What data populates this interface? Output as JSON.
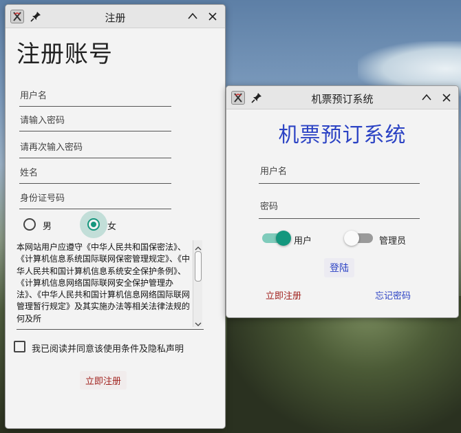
{
  "register_window": {
    "title": "注册",
    "heading": "注册账号",
    "fields": {
      "username_placeholder": "用户名",
      "password_placeholder": "请输入密码",
      "confirm_password_placeholder": "请再次输入密码",
      "name_placeholder": "姓名",
      "id_number_placeholder": "身份证号码"
    },
    "gender": {
      "male_label": "男",
      "female_label": "女",
      "selected": "女"
    },
    "terms_text": "本网站用户应遵守《中华人民共和国保密法》、《计算机信息系统国际联网保密管理规定》、《中华人民共和国计算机信息系统安全保护条例》、《计算机信息网络国际联网安全保护管理办法》、《中华人民共和国计算机信息网络国际联网管理暂行规定》及其实施办法等相关法律法规的何及所",
    "agree_checkbox_label": "我已阅读并同意该使用条件及隐私声明",
    "agree_checked": false,
    "submit_label": "立即注册"
  },
  "login_window": {
    "title": "机票预订系统",
    "heading": "机票预订系统",
    "username_placeholder": "用户名",
    "password_placeholder": "密码",
    "user_switch": {
      "label": "用户",
      "on": true
    },
    "admin_switch": {
      "label": "管理员",
      "on": false
    },
    "login_label": "登陆",
    "register_link_label": "立即注册",
    "forgot_link_label": "忘记密码"
  },
  "colors": {
    "accent_teal": "#16967d",
    "login_blue": "#2c43c4",
    "register_red": "#a0201c",
    "window_bg": "#f3f3f3",
    "titlebar_bg": "#e6e6e6"
  },
  "icons": {
    "app_icon": "app-icon",
    "pin": "pin-icon",
    "minimize": "chevron-up-icon",
    "close": "close-icon"
  }
}
